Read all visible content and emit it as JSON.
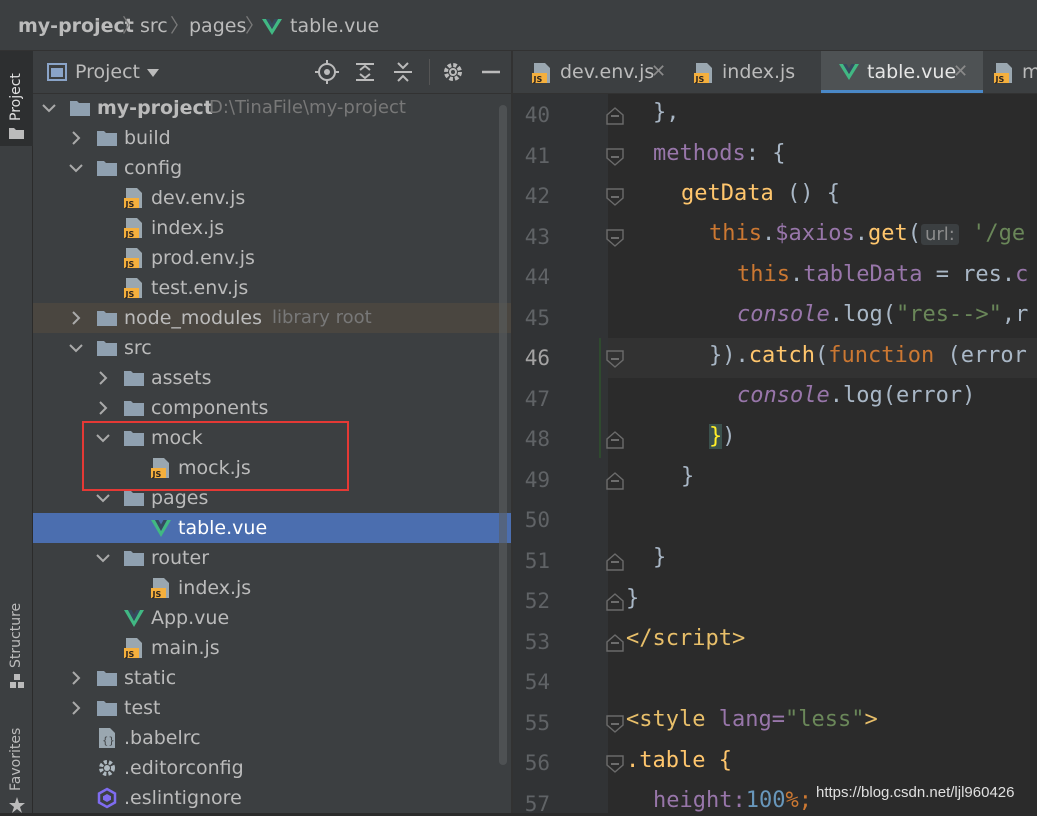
{
  "breadcrumb": {
    "project": "my-project",
    "folder": "src",
    "subfolder": "pages",
    "file": "table.vue"
  },
  "stripe": {
    "project_tab": "Project",
    "structure_tab": "Structure",
    "favorites_tab": "Favorites"
  },
  "project_panel": {
    "title": "Project",
    "tree": [
      {
        "label": "my-project",
        "hint": "D:\\TinaFile\\my-project",
        "type": "folder",
        "depth": 0,
        "expanded": true
      },
      {
        "label": "build",
        "type": "folder",
        "depth": 1,
        "expanded": false
      },
      {
        "label": "config",
        "type": "folder",
        "depth": 1,
        "expanded": true
      },
      {
        "label": "dev.env.js",
        "type": "js",
        "depth": 2
      },
      {
        "label": "index.js",
        "type": "js",
        "depth": 2
      },
      {
        "label": "prod.env.js",
        "type": "js",
        "depth": 2
      },
      {
        "label": "test.env.js",
        "type": "js",
        "depth": 2
      },
      {
        "label": "node_modules",
        "hint": "library root",
        "type": "folder",
        "depth": 1,
        "expanded": false,
        "excluded": true
      },
      {
        "label": "src",
        "type": "folder",
        "depth": 1,
        "expanded": true
      },
      {
        "label": "assets",
        "type": "folder",
        "depth": 2,
        "expanded": false
      },
      {
        "label": "components",
        "type": "folder",
        "depth": 2,
        "expanded": false
      },
      {
        "label": "mock",
        "type": "folder",
        "depth": 2,
        "expanded": true
      },
      {
        "label": "mock.js",
        "type": "js",
        "depth": 3
      },
      {
        "label": "pages",
        "type": "folder",
        "depth": 2,
        "expanded": true
      },
      {
        "label": "table.vue",
        "type": "vue",
        "depth": 3,
        "selected": true
      },
      {
        "label": "router",
        "type": "folder",
        "depth": 2,
        "expanded": true
      },
      {
        "label": "index.js",
        "type": "js",
        "depth": 3
      },
      {
        "label": "App.vue",
        "type": "vue",
        "depth": 2
      },
      {
        "label": "main.js",
        "type": "js",
        "depth": 2
      },
      {
        "label": "static",
        "type": "folder",
        "depth": 1,
        "expanded": false
      },
      {
        "label": "test",
        "type": "folder",
        "depth": 1,
        "expanded": false
      },
      {
        "label": ".babelrc",
        "type": "config",
        "depth": 1
      },
      {
        "label": ".editorconfig",
        "type": "gear",
        "depth": 1
      },
      {
        "label": ".eslintignore",
        "type": "eslint",
        "depth": 1
      }
    ]
  },
  "tabs": [
    {
      "label": "dev.env.js",
      "type": "js",
      "closable": true
    },
    {
      "label": "index.js",
      "type": "js",
      "closable": false
    },
    {
      "label": "table.vue",
      "type": "vue",
      "closable": true,
      "active": true
    },
    {
      "label": "m",
      "type": "js",
      "closable": false
    }
  ],
  "editor": {
    "current_line": "46",
    "line_numbers": [
      "40",
      "41",
      "42",
      "43",
      "44",
      "45",
      "46",
      "47",
      "48",
      "49",
      "50",
      "51",
      "52",
      "53",
      "54",
      "55",
      "56",
      "57"
    ],
    "inlay_hint": "url:",
    "code": {
      "l40": "},",
      "l41_a": "methods",
      "l41_b": ": {",
      "l42_a": "getData",
      "l42_b": " () {",
      "l43_a": "this",
      "l43_b": ".",
      "l43_c": "$axios",
      "l43_d": ".",
      "l43_e": "get",
      "l43_f": "(",
      "l43_g": "'/ge",
      "l44_a": "this",
      "l44_b": ".",
      "l44_c": "tableData",
      "l44_d": " = res.",
      "l44_e": "c",
      "l45_a": "console",
      "l45_b": ".log(",
      "l45_c": "\"res-->\"",
      "l45_d": ",r",
      "l46_a": "}).",
      "l46_b": "catch",
      "l46_c": "(",
      "l46_d": "function",
      "l46_e": " (error",
      "l47_a": "console",
      "l47_b": ".log(error)",
      "l48_a": "}",
      "l48_b": ")",
      "l49": "}",
      "l51": "}",
      "l52": "}",
      "l53_a": "</",
      "l53_b": "script",
      "l53_c": ">",
      "l55_a": "<",
      "l55_b": "style",
      "l55_c": " lang=",
      "l55_d": "\"less\"",
      "l55_e": ">",
      "l56": ".table {",
      "l57_a": "height:",
      "l57_b": "100",
      "l57_c": "%;"
    }
  },
  "watermark": "https://blog.csdn.net/ljl960426",
  "colors": {
    "accent": "#4a88c7",
    "selection": "#4b6eaf",
    "highlight_box": "#e53935",
    "vue_green": "#41b883"
  }
}
